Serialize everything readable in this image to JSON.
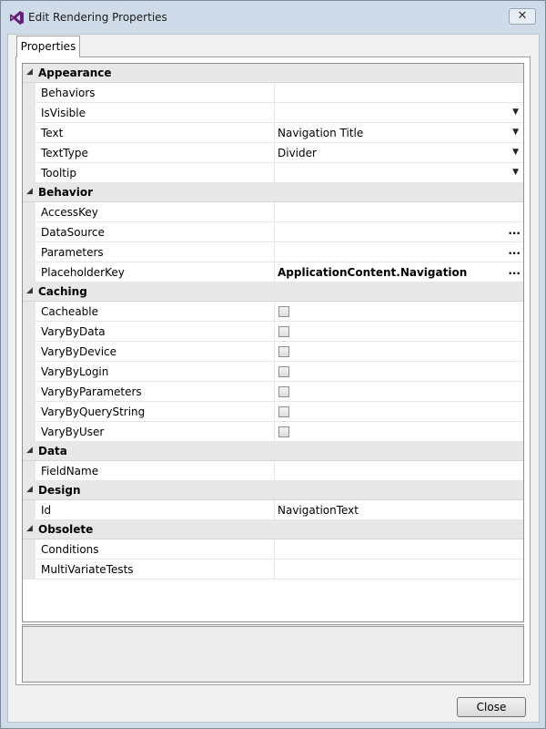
{
  "window": {
    "title": "Edit Rendering Properties",
    "close_glyph": "✕"
  },
  "tab": {
    "label": "Properties"
  },
  "groups": [
    {
      "name": "Appearance",
      "rows": [
        {
          "name": "Behaviors",
          "value": "",
          "editor": "text"
        },
        {
          "name": "IsVisible",
          "value": "",
          "editor": "dropdown"
        },
        {
          "name": "Text",
          "value": "Navigation Title",
          "editor": "dropdown"
        },
        {
          "name": "TextType",
          "value": "Divider",
          "editor": "dropdown"
        },
        {
          "name": "Tooltip",
          "value": "",
          "editor": "dropdown"
        }
      ]
    },
    {
      "name": "Behavior",
      "rows": [
        {
          "name": "AccessKey",
          "value": "",
          "editor": "text"
        },
        {
          "name": "DataSource",
          "value": "",
          "editor": "ellipsis"
        },
        {
          "name": "Parameters",
          "value": "",
          "editor": "ellipsis"
        },
        {
          "name": "PlaceholderKey",
          "value": "ApplicationContent.Navigation",
          "editor": "ellipsis",
          "bold": true
        }
      ]
    },
    {
      "name": "Caching",
      "rows": [
        {
          "name": "Cacheable",
          "value": "",
          "editor": "checkbox"
        },
        {
          "name": "VaryByData",
          "value": "",
          "editor": "checkbox"
        },
        {
          "name": "VaryByDevice",
          "value": "",
          "editor": "checkbox"
        },
        {
          "name": "VaryByLogin",
          "value": "",
          "editor": "checkbox"
        },
        {
          "name": "VaryByParameters",
          "value": "",
          "editor": "checkbox"
        },
        {
          "name": "VaryByQueryString",
          "value": "",
          "editor": "checkbox"
        },
        {
          "name": "VaryByUser",
          "value": "",
          "editor": "checkbox"
        }
      ]
    },
    {
      "name": "Data",
      "rows": [
        {
          "name": "FieldName",
          "value": "",
          "editor": "text"
        }
      ]
    },
    {
      "name": "Design",
      "rows": [
        {
          "name": "Id",
          "value": "NavigationText",
          "editor": "text"
        }
      ]
    },
    {
      "name": "Obsolete",
      "rows": [
        {
          "name": "Conditions",
          "value": "",
          "editor": "text"
        },
        {
          "name": "MultiVariateTests",
          "value": "",
          "editor": "text"
        }
      ]
    }
  ],
  "glyphs": {
    "collapse": "◢",
    "dropdown": "▼",
    "ellipsis": "..."
  },
  "buttons": {
    "close_label": "Close"
  },
  "colors": {
    "icon_purple": "#68217a",
    "group_bg": "#e8e8e8"
  }
}
